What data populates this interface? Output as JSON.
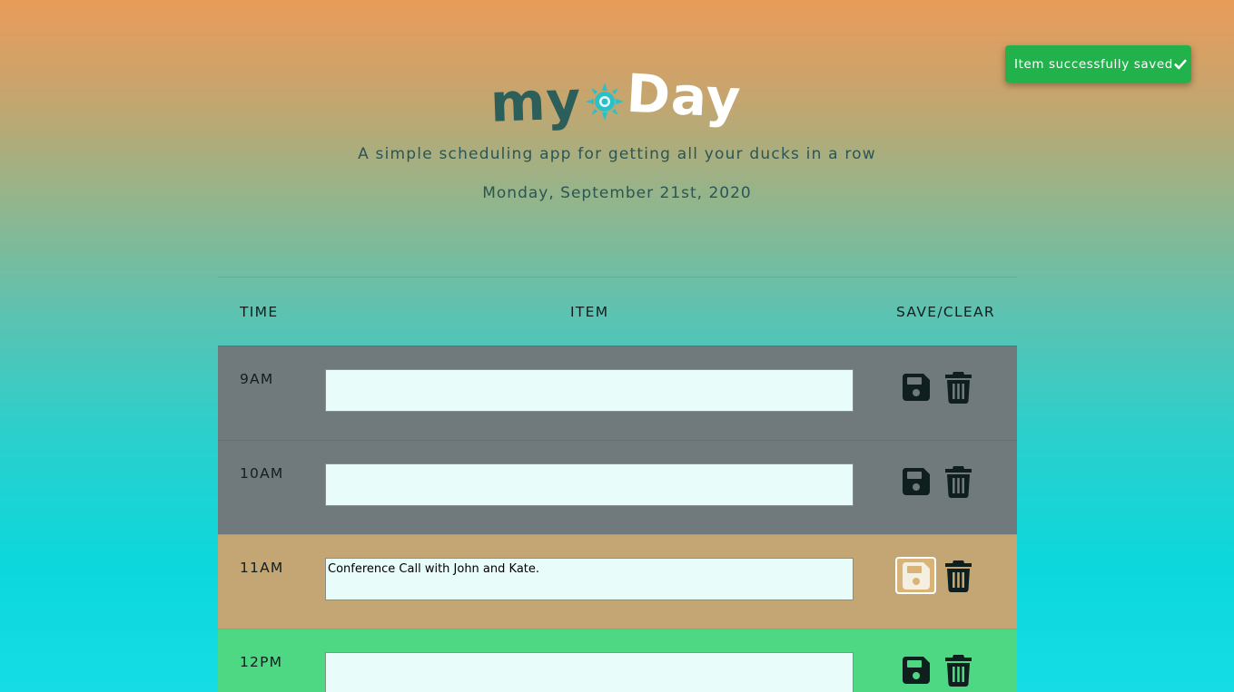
{
  "toast": {
    "message": "Item successfully saved",
    "icon": "check-icon"
  },
  "header": {
    "logo_part1": "my",
    "logo_part2": "Day",
    "logo_icon": "sun-icon",
    "subtitle": "A simple scheduling app for getting all your ducks in a row",
    "date": "Monday, September 21st, 2020"
  },
  "table": {
    "columns": [
      "TIME",
      "ITEM",
      "SAVE/CLEAR"
    ],
    "rows": [
      {
        "hour": "9AM",
        "item": "",
        "status": "past"
      },
      {
        "hour": "10AM",
        "item": "",
        "status": "past"
      },
      {
        "hour": "11AM",
        "item": "Conference Call with John and Kate.",
        "status": "present"
      },
      {
        "hour": "12PM",
        "item": "",
        "status": "future"
      }
    ],
    "save_icon": "floppy-disk-icon",
    "clear_icon": "trash-icon"
  },
  "colors": {
    "past": "#70797b",
    "present": "#c3a673",
    "future": "#4fd884",
    "toast": "#22b24c",
    "logo_my": "#2c5f5a",
    "logo_sun": "#2bbfc7"
  }
}
